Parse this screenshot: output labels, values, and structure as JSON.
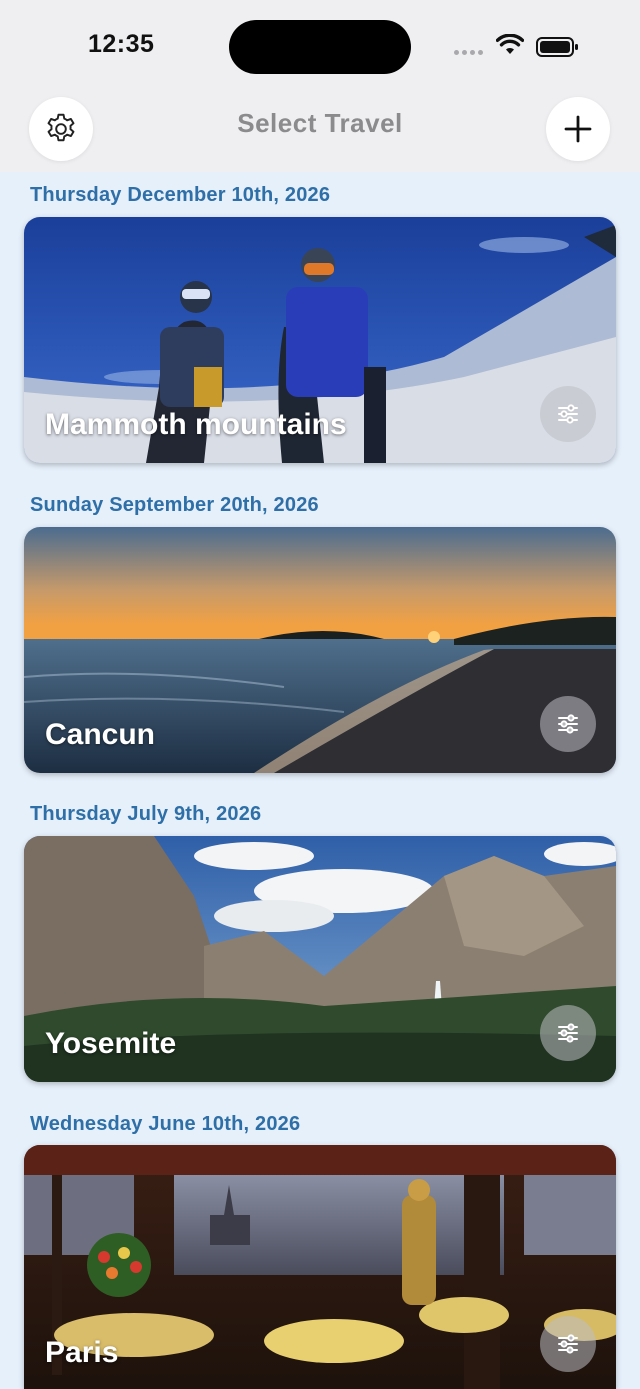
{
  "status_bar": {
    "time": "12:35"
  },
  "nav": {
    "title": "Select Travel",
    "settings_icon": "gear-icon",
    "add_icon": "plus-icon"
  },
  "trips": [
    {
      "date": "Thursday December 10th, 2026",
      "name": "Mammoth mountains",
      "scene": "snowy slope, two snowboarders, blue sky"
    },
    {
      "date": "Sunday September 20th, 2026",
      "name": "Cancun",
      "scene": "beach at sunset"
    },
    {
      "date": "Thursday July 9th, 2026",
      "name": "Yosemite",
      "scene": "granite cliffs, waterfall, forest valley"
    },
    {
      "date": "Wednesday June 10th, 2026",
      "name": "Paris",
      "scene": "restaurant interior with city view"
    }
  ],
  "colors": {
    "background": "#e6f0fb",
    "date_text": "#2f6fa7",
    "title_text": "#8b8b8e",
    "card_title": "#ffffff"
  }
}
